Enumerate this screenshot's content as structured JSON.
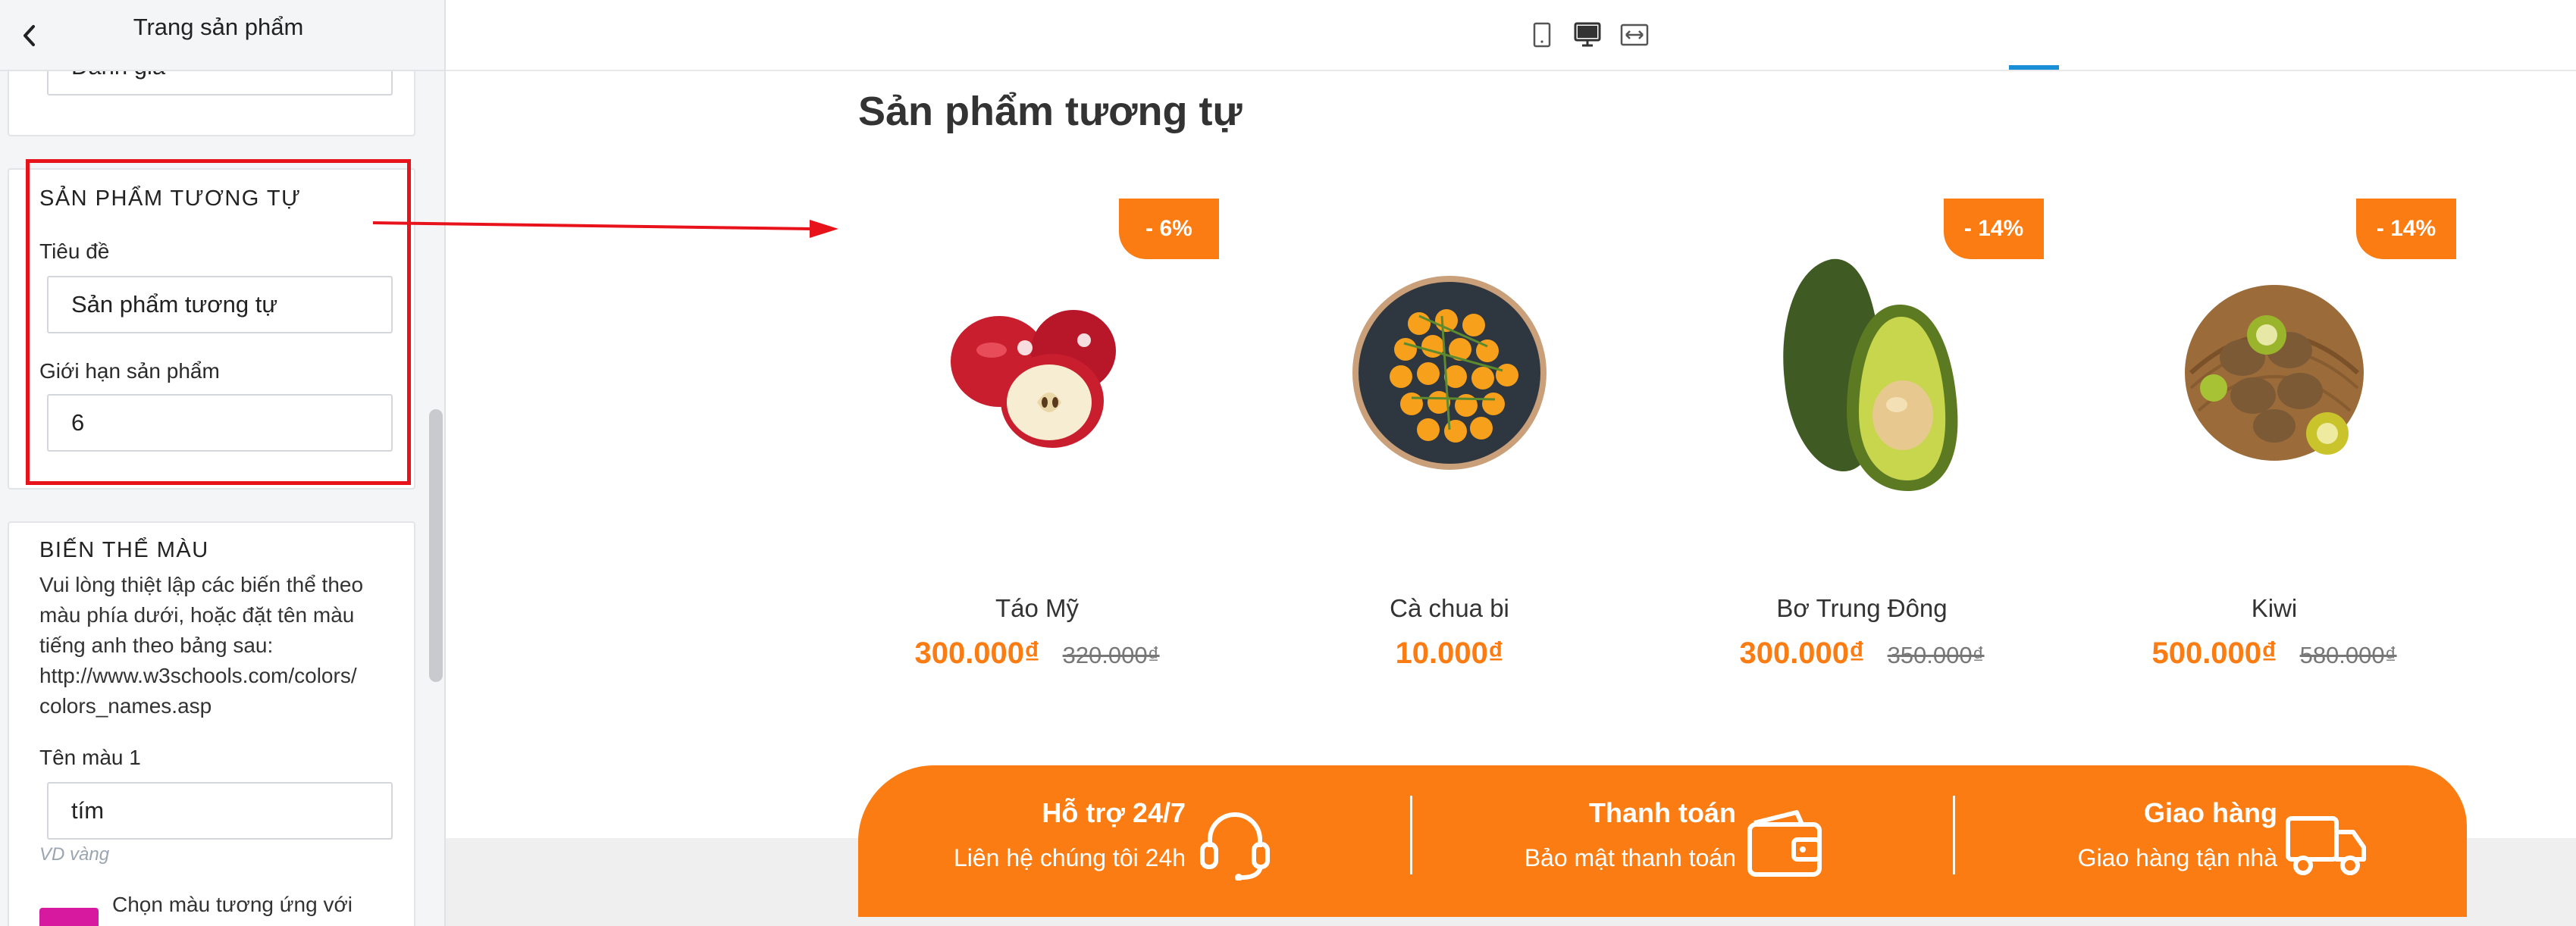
{
  "sidebar": {
    "title": "Trang sản phẩm",
    "prev_field_value": "Đánh giá",
    "related_section": {
      "title": "SẢN PHẨM TƯƠNG TỰ",
      "title_label": "Tiêu đề",
      "title_value": "Sản phẩm tương tự",
      "limit_label": "Giới hạn sản phẩm",
      "limit_value": "6"
    },
    "color_variant_section": {
      "title": "BIẾN THỂ MÀU",
      "description_lines": [
        "Vui lòng thiệt lập các biến thể theo",
        "màu phía dưới, hoặc đặt tên màu",
        "tiếng anh theo bảng sau:",
        "http://www.w3schools.com/colors/",
        "colors_names.asp"
      ],
      "color1_label": "Tên màu 1",
      "color1_value": "tím",
      "color1_hint": "VD vàng",
      "swatch_color": "#d6199e",
      "swatch_label": "Chọn màu tương ứng với"
    }
  },
  "device_toolbar": {
    "buttons": [
      "mobile-icon",
      "desktop-icon",
      "fullwidth-icon"
    ],
    "active": "desktop-icon",
    "accent_color": "#1a8fd6"
  },
  "preview": {
    "section_title": "Sản phẩm tương tự",
    "accent_color": "#fb7c12",
    "products": [
      {
        "name": "Táo Mỹ",
        "price": "300.000₫",
        "old_price": "320.000₫",
        "badge": "- 6%",
        "image": "apple"
      },
      {
        "name": "Cà chua bi",
        "price": "10.000₫",
        "old_price": "",
        "badge": "",
        "image": "cherry-tomato"
      },
      {
        "name": "Bơ Trung Đông",
        "price": "300.000₫",
        "old_price": "350.000₫",
        "badge": "- 14%",
        "image": "avocado"
      },
      {
        "name": "Kiwi",
        "price": "500.000₫",
        "old_price": "580.000₫",
        "badge": "- 14%",
        "image": "kiwi"
      }
    ],
    "services": [
      {
        "title": "Hỗ trợ 24/7",
        "subtitle": "Liên hệ chúng tôi 24h",
        "icon": "headset-icon"
      },
      {
        "title": "Thanh toán",
        "subtitle": "Bảo mật thanh toán",
        "icon": "wallet-icon"
      },
      {
        "title": "Giao hàng",
        "subtitle": "Giao hàng tận nhà",
        "icon": "truck-icon"
      }
    ]
  }
}
